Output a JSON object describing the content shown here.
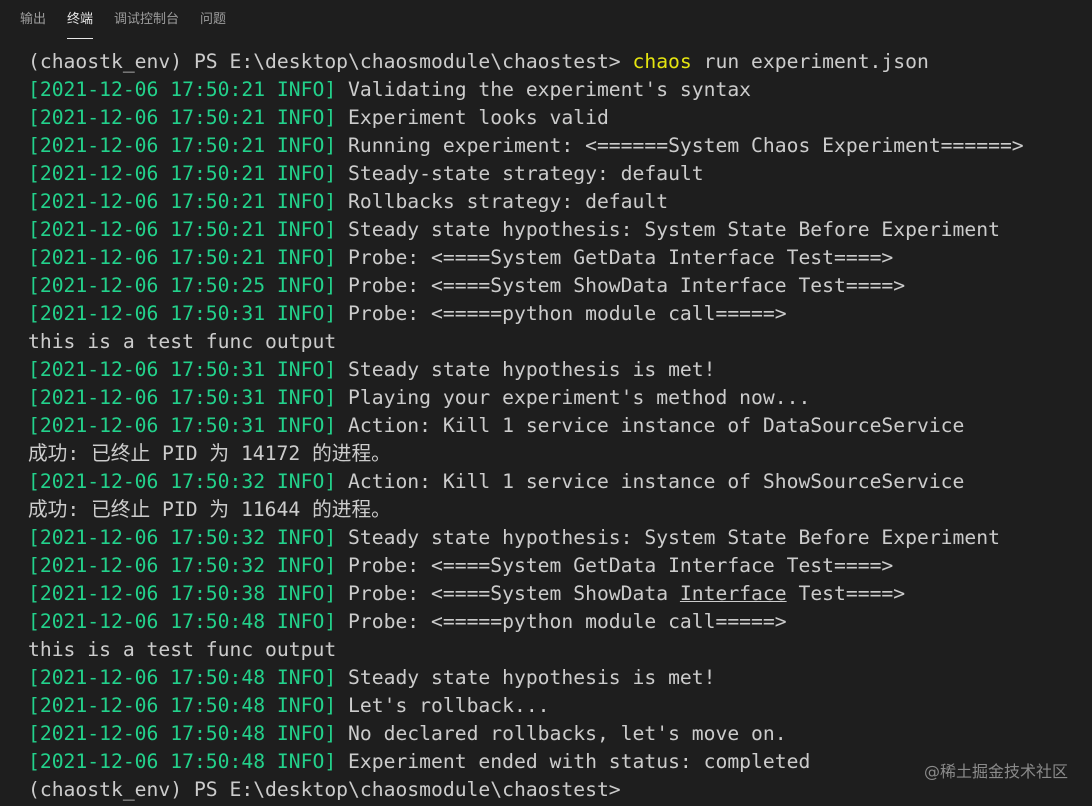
{
  "panel": {
    "tabs": [
      {
        "label": "输出",
        "active": false
      },
      {
        "label": "终端",
        "active": true
      },
      {
        "label": "调试控制台",
        "active": false
      },
      {
        "label": "问题",
        "active": false
      }
    ]
  },
  "terminal": {
    "prompt_prefix": "(chaostk_env) PS E:\\desktop\\chaosmodule\\chaostest> ",
    "command_name": "chaos",
    "command_args": " run experiment.json",
    "log": [
      {
        "ts": "[2021-12-06 17:50:21 INFO]",
        "msg": " Validating the experiment's syntax"
      },
      {
        "ts": "[2021-12-06 17:50:21 INFO]",
        "msg": " Experiment looks valid"
      },
      {
        "ts": "[2021-12-06 17:50:21 INFO]",
        "msg": " Running experiment: <======System Chaos Experiment======>"
      },
      {
        "ts": "[2021-12-06 17:50:21 INFO]",
        "msg": " Steady-state strategy: default"
      },
      {
        "ts": "[2021-12-06 17:50:21 INFO]",
        "msg": " Rollbacks strategy: default"
      },
      {
        "ts": "[2021-12-06 17:50:21 INFO]",
        "msg": " Steady state hypothesis: System State Before Experiment"
      },
      {
        "ts": "[2021-12-06 17:50:21 INFO]",
        "msg": " Probe: <====System GetData Interface Test====>"
      },
      {
        "ts": "[2021-12-06 17:50:25 INFO]",
        "msg": " Probe: <====System ShowData Interface Test====>"
      },
      {
        "ts": "[2021-12-06 17:50:31 INFO]",
        "msg": " Probe: <=====python module call=====>"
      },
      {
        "text": "this is a test func output"
      },
      {
        "ts": "[2021-12-06 17:50:31 INFO]",
        "msg": " Steady state hypothesis is met!"
      },
      {
        "ts": "[2021-12-06 17:50:31 INFO]",
        "msg": " Playing your experiment's method now..."
      },
      {
        "ts": "[2021-12-06 17:50:31 INFO]",
        "msg": " Action: Kill 1 service instance of DataSourceService"
      },
      {
        "text": "成功: 已终止 PID 为 14172 的进程。"
      },
      {
        "ts": "[2021-12-06 17:50:32 INFO]",
        "msg": " Action: Kill 1 service instance of ShowSourceService"
      },
      {
        "text": "成功: 已终止 PID 为 11644 的进程。"
      },
      {
        "ts": "[2021-12-06 17:50:32 INFO]",
        "msg": " Steady state hypothesis: System State Before Experiment"
      },
      {
        "ts": "[2021-12-06 17:50:32 INFO]",
        "msg": " Probe: <====System GetData Interface Test====>"
      },
      {
        "ts": "[2021-12-06 17:50:38 INFO]",
        "pre": " Probe: <====System ShowData ",
        "link": "Interface",
        "post": " Test====>"
      },
      {
        "ts": "[2021-12-06 17:50:48 INFO]",
        "msg": " Probe: <=====python module call=====>"
      },
      {
        "text": "this is a test func output"
      },
      {
        "ts": "[2021-12-06 17:50:48 INFO]",
        "msg": " Steady state hypothesis is met!"
      },
      {
        "ts": "[2021-12-06 17:50:48 INFO]",
        "msg": " Let's rollback..."
      },
      {
        "ts": "[2021-12-06 17:50:48 INFO]",
        "msg": " No declared rollbacks, let's move on."
      },
      {
        "ts": "[2021-12-06 17:50:48 INFO]",
        "msg": " Experiment ended with status: completed"
      }
    ],
    "final_prompt": "(chaostk_env) PS E:\\desktop\\chaosmodule\\chaostest>"
  },
  "watermark": "@稀土掘金技术社区",
  "colors": {
    "background": "#1e1e1e",
    "timestamp": "#23d18b",
    "command": "#e5e510",
    "text": "#cccccc"
  }
}
